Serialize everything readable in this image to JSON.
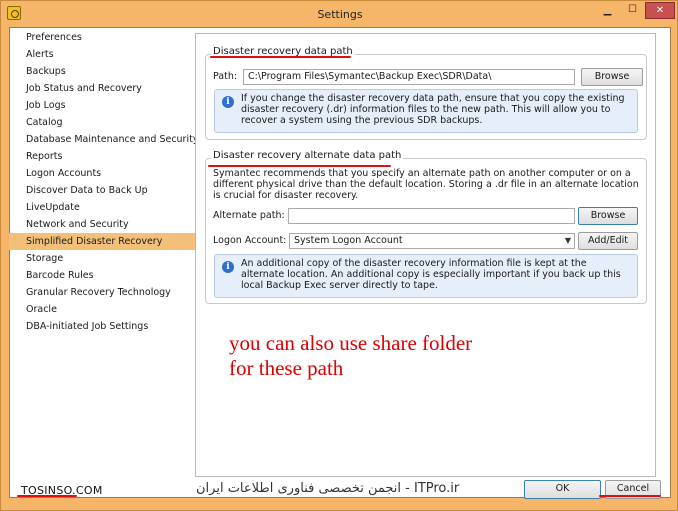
{
  "window": {
    "title": "Settings"
  },
  "titlebar": {
    "minimize": "▁",
    "maximize": "☐",
    "close": "✕"
  },
  "sidebar": {
    "items": [
      {
        "label": "Preferences",
        "selected": false
      },
      {
        "label": "Alerts",
        "selected": false
      },
      {
        "label": "Backups",
        "selected": false
      },
      {
        "label": "Job Status and Recovery",
        "selected": false
      },
      {
        "label": "Job Logs",
        "selected": false
      },
      {
        "label": "Catalog",
        "selected": false
      },
      {
        "label": "Database Maintenance and Security",
        "selected": false
      },
      {
        "label": "Reports",
        "selected": false
      },
      {
        "label": "Logon Accounts",
        "selected": false
      },
      {
        "label": "Discover Data to Back Up",
        "selected": false
      },
      {
        "label": "LiveUpdate",
        "selected": false
      },
      {
        "label": "Network and Security",
        "selected": false
      },
      {
        "label": "Simplified Disaster Recovery",
        "selected": true
      },
      {
        "label": "Storage",
        "selected": false
      },
      {
        "label": "Barcode Rules",
        "selected": false
      },
      {
        "label": "Granular Recovery Technology",
        "selected": false
      },
      {
        "label": "Oracle",
        "selected": false
      },
      {
        "label": "DBA-initiated Job Settings",
        "selected": false
      }
    ]
  },
  "dr_path": {
    "title": "Disaster recovery data path",
    "path_label": "Path:",
    "path_value": "C:\\Program Files\\Symantec\\Backup Exec\\SDR\\Data\\",
    "browse_label": "Browse",
    "info_text": "If you change the disaster recovery data path, ensure that you copy the existing disaster recovery (.dr) information files to the new path. This will allow you to recover a system using the previous SDR backups."
  },
  "dr_alt_path": {
    "title": "Disaster recovery alternate data path",
    "description": "Symantec recommends that you specify an alternate path on another computer or on a different physical drive than the default location. Storing a .dr file in an alternate location is crucial for disaster recovery.",
    "alt_path_label": "Alternate path:",
    "alt_path_value": "",
    "browse_label": "Browse",
    "logon_label": "Logon Account:",
    "logon_value": "System Logon Account",
    "add_edit_label": "Add/Edit",
    "info_text": "An additional copy of the disaster recovery information file is kept at the alternate location. An additional copy is especially important if you back up this local Backup Exec server directly to tape."
  },
  "annotation": {
    "text": "you can also use share folder\nfor these path"
  },
  "footer": {
    "watermark_left": "TOSINSO.COM",
    "watermark_mid": "انجمن تخصصی فناوری اطلاعات ایران - ITPro.ir",
    "ok_label": "OK",
    "cancel_label": "Cancel"
  },
  "colors": {
    "accent": "#f6b66a",
    "selected": "#f3c07a",
    "annotation": "#dd0000",
    "info_bg": "#e6eef9"
  }
}
